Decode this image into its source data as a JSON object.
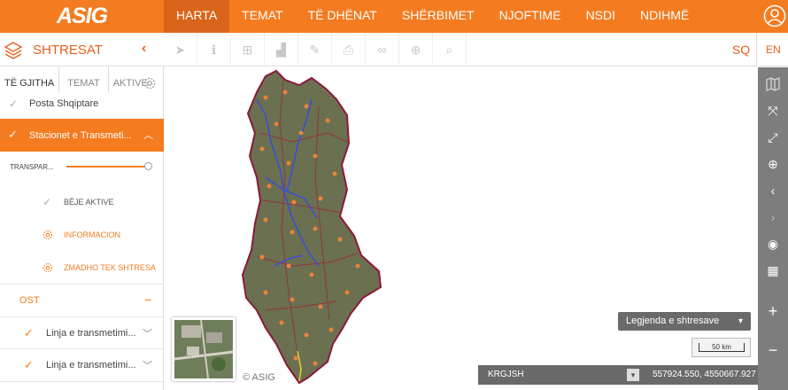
{
  "app": {
    "logo": "ASIG"
  },
  "nav": {
    "items": [
      "HARTA",
      "TEMAT",
      "TË DHËNAT",
      "SHËRBIMET",
      "NJOFTIME",
      "NSDI",
      "NDIHMË"
    ]
  },
  "toolbar": {
    "layers_title": "SHTRESAT",
    "collapse": "‹",
    "lang_sq": "SQ",
    "lang_en": "EN"
  },
  "sidebar": {
    "tabs": [
      "TË GJITHA",
      "TEMAT",
      "AKTIVE"
    ],
    "layers": [
      {
        "label": "Posta Shqiptare"
      },
      {
        "label": "Stacionet e Transmeti..."
      }
    ],
    "transparency_label": "TRANSPAR...",
    "actions": [
      "BËJE AKTIVE",
      "INFORMACION",
      "ZMADHO TEK SHTRESA"
    ],
    "group": "OST",
    "group_items": [
      "Linja e transmetimi...",
      "Linja e transmetimi..."
    ]
  },
  "map": {
    "copyright": "© ASIG",
    "legend_label": "Legjenda e shtresave",
    "scale_label": "50 km",
    "crs": "KRGJSH",
    "coordinates": "557924.550, 4550667.927"
  },
  "colors": {
    "accent": "#f47b20",
    "accent_dark": "#d9651a",
    "panel": "#6a6a6a"
  }
}
